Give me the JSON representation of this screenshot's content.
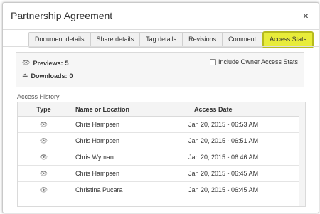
{
  "dialog": {
    "title": "Partnership Agreement",
    "close_glyph": "×"
  },
  "tabs": [
    {
      "label": "Document details",
      "active": false
    },
    {
      "label": "Share details",
      "active": false
    },
    {
      "label": "Tag details",
      "active": false
    },
    {
      "label": "Revisions",
      "active": false
    },
    {
      "label": "Comment",
      "active": false
    },
    {
      "label": "Access Stats",
      "active": true
    }
  ],
  "stats": {
    "previews_label": "Previews:",
    "previews_value": "5",
    "previews_icon": "eye-icon",
    "downloads_label": "Downloads:",
    "downloads_value": "0",
    "downloads_icon": "download-icon",
    "owner_checkbox_label": "Include Owner Access Stats",
    "owner_checkbox_checked": false
  },
  "history": {
    "label": "Access History",
    "columns": [
      "Type",
      "Name or Location",
      "Access Date"
    ],
    "rows": [
      {
        "type_icon": "eye-icon",
        "name": "Chris Hampsen",
        "date": "Jan 20, 2015 - 06:53 AM"
      },
      {
        "type_icon": "eye-icon",
        "name": "Chris Hampsen",
        "date": "Jan 20, 2015 - 06:51 AM"
      },
      {
        "type_icon": "eye-icon",
        "name": "Chris Wyman",
        "date": "Jan 20, 2015 - 06:46 AM"
      },
      {
        "type_icon": "eye-icon",
        "name": "Chris Hampsen",
        "date": "Jan 20, 2015 - 06:45 AM"
      },
      {
        "type_icon": "eye-icon",
        "name": "Christina Pucara",
        "date": "Jan 20, 2015 - 06:45 AM"
      }
    ]
  },
  "colors": {
    "active_tab": "#e8ec3a",
    "stats_background": "#f6f6f6"
  }
}
